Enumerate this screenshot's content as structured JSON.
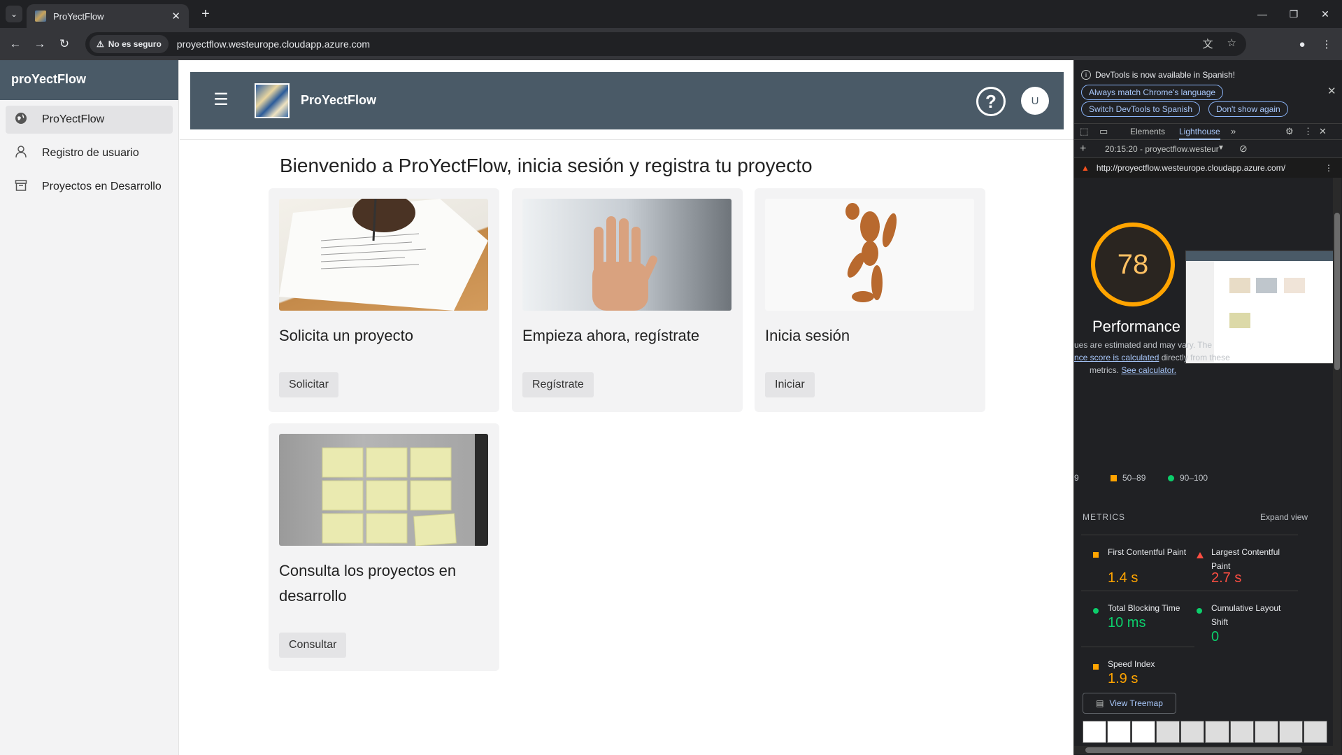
{
  "browser": {
    "tab_title": "ProYectFlow",
    "security_label": "No es seguro",
    "url": "proyectflow.westeurope.cloudapp.azure.com",
    "icons": {
      "tab_dropdown": "chevron-down-icon",
      "tab_close": "close-icon",
      "new_tab": "plus-icon",
      "back": "arrow-left-icon",
      "forward": "arrow-right-icon",
      "reload": "reload-icon",
      "warning": "warning-icon",
      "translate": "translate-icon",
      "bookmark": "star-icon",
      "profile": "person-icon",
      "menu": "kebab-icon"
    }
  },
  "sidebar": {
    "title": "proYectFlow",
    "items": [
      {
        "label": "ProYectFlow",
        "icon": "globe-icon",
        "active": true
      },
      {
        "label": "Registro de usuario",
        "icon": "person-icon",
        "active": false
      },
      {
        "label": "Proyectos en Desarrollo",
        "icon": "archive-icon",
        "active": false
      }
    ]
  },
  "appbar": {
    "brand": "ProYectFlow",
    "help_glyph": "?",
    "avatar_initial": "U"
  },
  "main": {
    "welcome": "Bienvenido a ProYectFlow, inicia sesión y registra tu proyecto",
    "cards": [
      {
        "title": "Solicita un proyecto",
        "button": "Solicitar",
        "image": "hand-signing-document-photo"
      },
      {
        "title": "Empieza ahora, regístrate",
        "button": "Regístrate",
        "image": "raised-hand-photo"
      },
      {
        "title": "Inicia sesión",
        "button": "Iniciar",
        "image": "wooden-mannequin-photo"
      },
      {
        "title": "Consulta los proyectos en desarrollo",
        "button": "Consultar",
        "image": "sticky-notes-wall-photo"
      }
    ]
  },
  "devtools": {
    "banner": "DevTools is now available in Spanish!",
    "pills": [
      "Always match Chrome's language",
      "Switch DevTools to Spanish",
      "Don't show again"
    ],
    "tabs": [
      "Elements",
      "Lighthouse"
    ],
    "active_tab": "Lighthouse",
    "report_select": "20:15:20 - proyectflow.westeur",
    "report_url": "http://proyectflow.westeurope.cloudapp.azure.com/",
    "score": "78",
    "category": "Performance",
    "note_line1": "ues are estimated and may vary. The",
    "note_link1": "nce score is calculated",
    "note_line2_rest": " directly from these",
    "note_line3": "metrics. ",
    "note_link2": "See calculator.",
    "legend_left": "9",
    "legend_mid": "50–89",
    "legend_right": "90–100",
    "metrics_heading": "METRICS",
    "expand_view": "Expand view",
    "metrics": [
      {
        "name": "First Contentful Paint",
        "value": "1.4 s",
        "status": "average"
      },
      {
        "name": "Largest Contentful Paint",
        "value": "2.7 s",
        "status": "fail"
      },
      {
        "name": "Total Blocking Time",
        "value": "10 ms",
        "status": "pass"
      },
      {
        "name": "Cumulative Layout Shift",
        "value": "0",
        "status": "pass"
      },
      {
        "name": "Speed Index",
        "value": "1.9 s",
        "status": "average"
      }
    ],
    "treemap_button": "View Treemap",
    "colors": {
      "average": "#ffa400",
      "fail": "#ff4e42",
      "pass": "#0cce6b"
    }
  }
}
